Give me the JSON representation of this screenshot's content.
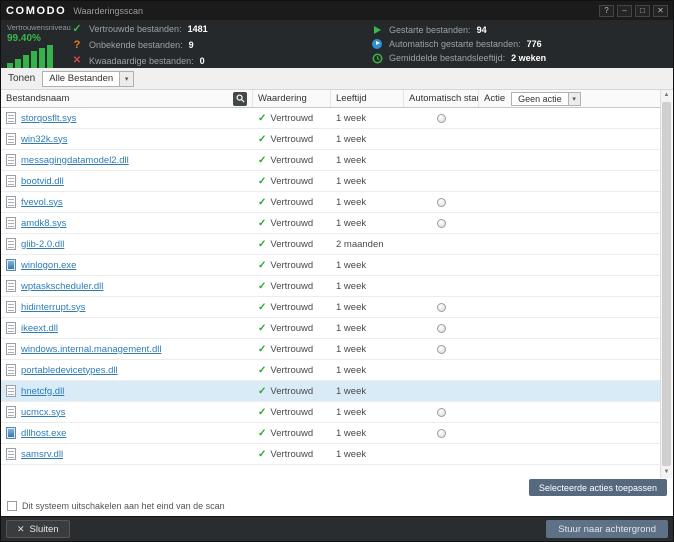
{
  "window": {
    "brand": "COMODO",
    "title": "Waarderingsscan",
    "controls": {
      "help": "?",
      "minimize": "–",
      "maximize": "□",
      "close": "✕"
    }
  },
  "icons": {
    "check": "✓",
    "question": "?",
    "cross": "✕",
    "caret_down": "▾",
    "up_arrow": "▲",
    "down_arrow": "▼"
  },
  "colors": {
    "accent_green": "#3cb54a",
    "link_blue": "#2e7cb7",
    "highlight_row": "#d8ebf7",
    "panel_dark": "#26292b",
    "button_slate": "#56697e"
  },
  "stats": {
    "trust": {
      "label": "Vertrouwensniveau",
      "value": "99.40%"
    },
    "file_stats": [
      {
        "label": "Vertrouwde bestanden:",
        "value": "1481"
      },
      {
        "label": "Onbekende bestanden:",
        "value": "9"
      },
      {
        "label": "Kwaadaardige bestanden:",
        "value": "0"
      }
    ],
    "run_stats": [
      {
        "label": "Gestarte bestanden:",
        "value": "94"
      },
      {
        "label": "Automatisch gestarte bestanden:",
        "value": "776"
      },
      {
        "label": "Gemiddelde bestandsleeftijd:",
        "value": "2 weken"
      }
    ]
  },
  "toolbar": {
    "label": "Tonen",
    "filter_dropdown": "Alle Bestanden"
  },
  "table": {
    "columns": {
      "name": "Bestandsnaam",
      "rating": "Waardering",
      "age": "Leeftijd",
      "auto": "Automatisch star...",
      "action": "Actie"
    },
    "action_dropdown": "Geen actie",
    "rows": [
      {
        "name": "storqosflt.sys",
        "icon": "doc",
        "rating": "Vertrouwd",
        "age": "1 week",
        "auto": true,
        "highlighted": false
      },
      {
        "name": "win32k.sys",
        "icon": "doc",
        "rating": "Vertrouwd",
        "age": "1 week",
        "auto": false,
        "highlighted": false
      },
      {
        "name": "messagingdatamodel2.dll",
        "icon": "doc",
        "rating": "Vertrouwd",
        "age": "1 week",
        "auto": false,
        "highlighted": false
      },
      {
        "name": "bootvid.dll",
        "icon": "doc",
        "rating": "Vertrouwd",
        "age": "1 week",
        "auto": false,
        "highlighted": false
      },
      {
        "name": "fvevol.sys",
        "icon": "doc",
        "rating": "Vertrouwd",
        "age": "1 week",
        "auto": true,
        "highlighted": false
      },
      {
        "name": "amdk8.sys",
        "icon": "doc",
        "rating": "Vertrouwd",
        "age": "1 week",
        "auto": true,
        "highlighted": false
      },
      {
        "name": "glib-2.0.dll",
        "icon": "doc",
        "rating": "Vertrouwd",
        "age": "2 maanden",
        "auto": false,
        "highlighted": false
      },
      {
        "name": "winlogon.exe",
        "icon": "exe",
        "rating": "Vertrouwd",
        "age": "1 week",
        "auto": false,
        "highlighted": false
      },
      {
        "name": "wptaskscheduler.dll",
        "icon": "doc",
        "rating": "Vertrouwd",
        "age": "1 week",
        "auto": false,
        "highlighted": false
      },
      {
        "name": "hidinterrupt.sys",
        "icon": "doc",
        "rating": "Vertrouwd",
        "age": "1 week",
        "auto": true,
        "highlighted": false
      },
      {
        "name": "ikeext.dll",
        "icon": "doc",
        "rating": "Vertrouwd",
        "age": "1 week",
        "auto": true,
        "highlighted": false
      },
      {
        "name": "windows.internal.management.dll",
        "icon": "doc",
        "rating": "Vertrouwd",
        "age": "1 week",
        "auto": true,
        "highlighted": false
      },
      {
        "name": "portabledevicetypes.dll",
        "icon": "doc",
        "rating": "Vertrouwd",
        "age": "1 week",
        "auto": false,
        "highlighted": false
      },
      {
        "name": "hnetcfg.dll",
        "icon": "doc",
        "rating": "Vertrouwd",
        "age": "1 week",
        "auto": false,
        "highlighted": true
      },
      {
        "name": "ucmcx.sys",
        "icon": "doc",
        "rating": "Vertrouwd",
        "age": "1 week",
        "auto": true,
        "highlighted": false
      },
      {
        "name": "dllhost.exe",
        "icon": "exe",
        "rating": "Vertrouwd",
        "age": "1 week",
        "auto": true,
        "highlighted": false
      },
      {
        "name": "samsrv.dll",
        "icon": "doc",
        "rating": "Vertrouwd",
        "age": "1 week",
        "auto": false,
        "highlighted": false
      }
    ]
  },
  "footer": {
    "apply_button": "Selecteerde acties toepassen",
    "shutdown_checkbox": "Dit systeem uitschakelen aan het eind van de scan",
    "close_button": "Sluiten",
    "background_button": "Stuur naar achtergrond"
  }
}
